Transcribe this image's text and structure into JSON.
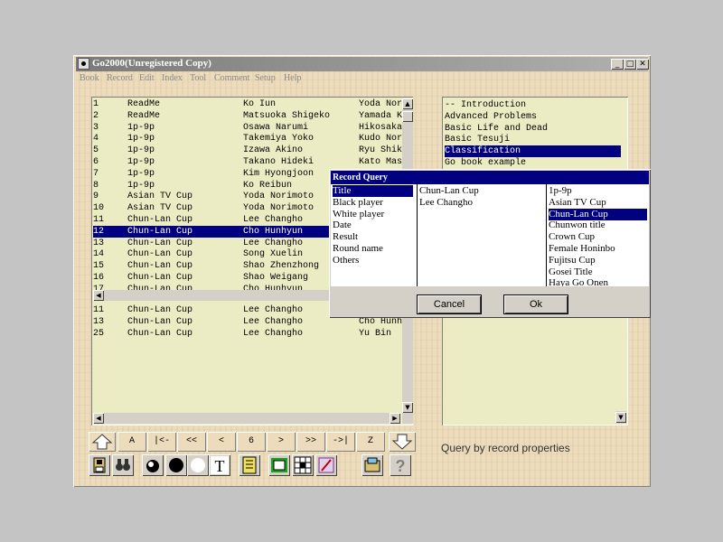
{
  "window": {
    "title": "Go2000(Unregistered Copy)",
    "minimize": "_",
    "maximize": "□",
    "close": "✕"
  },
  "menu": [
    "Book",
    "Record",
    "Edit",
    "Index",
    "Tool",
    "Comment",
    "Setup",
    "Help"
  ],
  "records": [
    {
      "no": "1",
      "event": "ReadMe",
      "black": "Ko Iun",
      "white": "Yoda Nor"
    },
    {
      "no": "2",
      "event": "ReadMe",
      "black": "Matsuoka Shigeko",
      "white": "Yamada K"
    },
    {
      "no": "3",
      "event": "1p-9p",
      "black": "Osawa Narumi",
      "white": "Hikosaka"
    },
    {
      "no": "4",
      "event": "1p-9p",
      "black": "Takemiya Yoko",
      "white": "Kudo Nor"
    },
    {
      "no": "5",
      "event": "1p-9p",
      "black": "Izawa Akino",
      "white": "Ryu Shik"
    },
    {
      "no": "6",
      "event": "1p-9p",
      "black": "Takano Hideki",
      "white": "Kato Mas"
    },
    {
      "no": "7",
      "event": "1p-9p",
      "black": "Kim Hyongjoon",
      "white": ""
    },
    {
      "no": "8",
      "event": "1p-9p",
      "black": "Ko Reibun",
      "white": ""
    },
    {
      "no": "9",
      "event": "Asian TV Cup",
      "black": "Yoda Norimoto",
      "white": ""
    },
    {
      "no": "10",
      "event": "Asian TV Cup",
      "black": "Yoda Norimoto",
      "white": ""
    },
    {
      "no": "11",
      "event": "Chun-Lan Cup",
      "black": "Lee Changho",
      "white": ""
    },
    {
      "no": "12",
      "event": "Chun-Lan Cup",
      "black": "Cho Hunhyun",
      "white": ""
    },
    {
      "no": "13",
      "event": "Chun-Lan Cup",
      "black": "Lee Changho",
      "white": ""
    },
    {
      "no": "14",
      "event": "Chun-Lan Cup",
      "black": "Song Xuelin",
      "white": ""
    },
    {
      "no": "15",
      "event": "Chun-Lan Cup",
      "black": "Shao Zhenzhong",
      "white": ""
    },
    {
      "no": "16",
      "event": "Chun-Lan Cup",
      "black": "Shao Weigang",
      "white": ""
    },
    {
      "no": "17",
      "event": "Chun-Lan Cup",
      "black": "Cho Hunhyun",
      "white": ""
    }
  ],
  "selected_record": "12",
  "results": [
    {
      "no": "11",
      "event": "Chun-Lan Cup",
      "black": "Lee Changho",
      "white": ""
    },
    {
      "no": "13",
      "event": "Chun-Lan Cup",
      "black": "Lee Changho",
      "white": "Cho Hunh"
    },
    {
      "no": "25",
      "event": "Chun-Lan Cup",
      "black": "Lee Changho",
      "white": "Yu Bin"
    }
  ],
  "books": [
    "-- Introduction",
    "Advanced Problems",
    "Basic Life and Dead",
    "Basic Tesuji",
    "Classification",
    "Go book example"
  ],
  "selected_book": "Classification",
  "status_text": "Query by record properties",
  "nav_buttons": [
    "A",
    "|<-",
    "<<",
    "<",
    "6",
    ">",
    ">>",
    "->|",
    "Z"
  ],
  "tools": [
    "save-icon",
    "binoculars-icon",
    "stone-icon",
    "black-stone-icon",
    "white-stone-icon",
    "text-icon",
    "notebook-icon",
    "board-icon",
    "grid-icon",
    "edit-icon",
    "folder-icon",
    "help-icon"
  ],
  "dialog": {
    "title": "Record Query",
    "fields": [
      "Title",
      "Black player",
      "White player",
      "Date",
      "Result",
      "Round name",
      "Others"
    ],
    "selected_field": "Title",
    "selected_values": [
      "Chun-Lan Cup",
      "Lee Changho"
    ],
    "values": [
      "1p-9p",
      "Asian TV Cup",
      "Chun-Lan Cup",
      "Chunwon title",
      "Crown Cup",
      "Female Honinbo",
      "Fujitsu Cup",
      "Gosei Title",
      "Haya Go Onen"
    ],
    "selected_value": "Chun-Lan Cup",
    "cancel": "Cancel",
    "ok": "Ok"
  }
}
